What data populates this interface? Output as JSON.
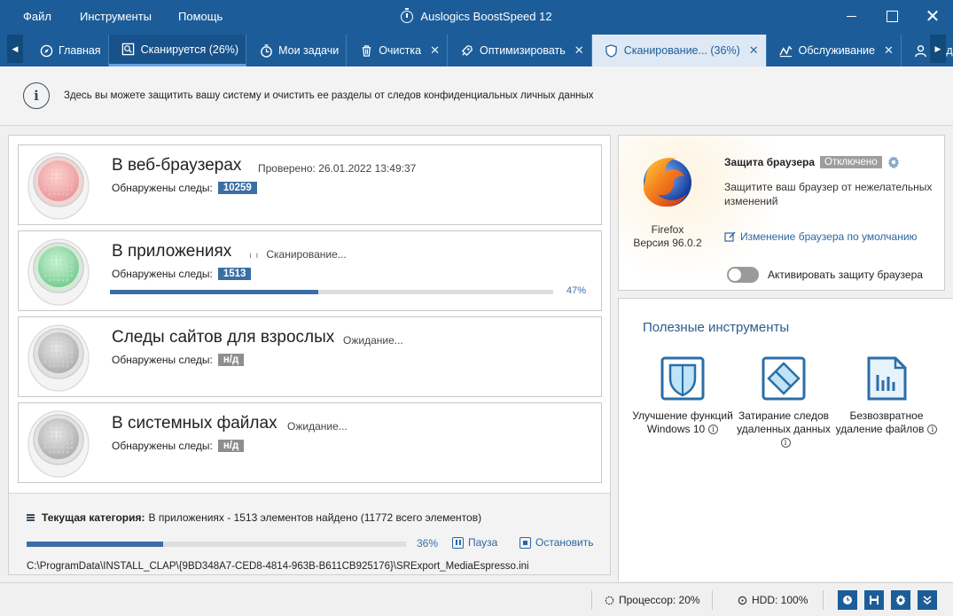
{
  "menu": [
    "Файл",
    "Инструменты",
    "Помощь"
  ],
  "app_title": "Auslogics BoostSpeed 12",
  "tabs": [
    {
      "label": "Главная",
      "icon": "compass-icon",
      "close": false,
      "state": "normal"
    },
    {
      "label": "Сканируется (26%)",
      "icon": "scan-icon",
      "close": false,
      "state": "active-dark"
    },
    {
      "label": "Мои задачи",
      "icon": "stopwatch-icon",
      "close": false,
      "state": "normal"
    },
    {
      "label": "Очистка",
      "icon": "trash-icon",
      "close": true,
      "state": "normal"
    },
    {
      "label": "Оптимизировать",
      "icon": "rocket-icon",
      "close": true,
      "state": "normal"
    },
    {
      "label": "Сканирование... (36%)",
      "icon": "shield-icon",
      "close": true,
      "state": "active-light"
    },
    {
      "label": "Обслуживание",
      "icon": "pulse-icon",
      "close": true,
      "state": "normal"
    },
    {
      "label": "Задать",
      "icon": "user-icon",
      "close": false,
      "state": "normal"
    }
  ],
  "info_text": "Здесь вы можете защитить вашу систему и очистить ее разделы от следов конфиденциальных личных данных",
  "found_label": "Обнаружены следы:",
  "categories": [
    {
      "name": "В веб-браузерах",
      "status": "Проверено: 26.01.2022 13:49:37",
      "count": "10259",
      "light": "red",
      "progress": null
    },
    {
      "name": "В приложениях",
      "status": "Сканирование...",
      "count": "1513",
      "light": "green",
      "progress": 0.47,
      "progress_text": "47%"
    },
    {
      "name": "Следы сайтов для взрослых",
      "status": "Ожидание...",
      "count": "н/д",
      "light": "grey",
      "progress": null
    },
    {
      "name": "В системных файлах",
      "status": "Ожидание...",
      "count": "н/д",
      "light": "grey",
      "progress": null
    }
  ],
  "current": {
    "label": "Текущая категория:",
    "value": "В приложениях - 1513 элементов найдено (11772 всего элементов)",
    "progress": 0.36,
    "progress_text": "36%",
    "pause": "Пауза",
    "stop": "Остановить",
    "path": "C:\\ProgramData\\INSTALL_CLAP\\{9BD348A7-CED8-4814-963B-B611CB925176}\\SRExport_MediaEspresso.ini"
  },
  "browser": {
    "name": "Firefox",
    "version": "Версия 96.0.2",
    "protection_title": "Защита браузера",
    "protection_state": "Отключено",
    "description": "Защитите ваш браузер от нежелательных изменений",
    "default_link": "Изменение браузера по умолчанию",
    "toggle_label": "Активировать защиту браузера"
  },
  "tools": {
    "title": "Полезные инструменты",
    "items": [
      {
        "label": "Улучшение функций Windows 10",
        "icon": "shield-windows-icon"
      },
      {
        "label": "Затирание следов удаленных данных",
        "icon": "eraser-icon"
      },
      {
        "label": "Безвозвратное удаление файлов",
        "icon": "file-shred-icon"
      }
    ]
  },
  "status": {
    "cpu": "Процессор: 20%",
    "hdd": "HDD: 100%"
  },
  "colors": {
    "primary": "#1c5d99",
    "accent": "#3b6ea5",
    "tab_light": "#dfe9f5"
  }
}
